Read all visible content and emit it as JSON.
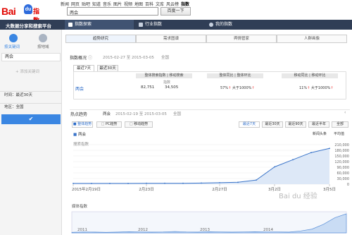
{
  "topnav": {
    "links": [
      "新闻",
      "网页",
      "贴吧",
      "知道",
      "音乐",
      "图片",
      "视频",
      "地图",
      "百科",
      "文库",
      "风云榜"
    ],
    "active": "指数"
  },
  "logo": {
    "text_bai": "Bai",
    "text_du": "du",
    "text_index": "指数"
  },
  "search": {
    "value": "两会",
    "button": "百度一下"
  },
  "header": {
    "brand": "大数据分享和搜索平台",
    "tabs": [
      "指数探索",
      "行业指数",
      "我的指数"
    ],
    "colors": {
      "bar": "#303e56",
      "active": "#405372"
    }
  },
  "subtabs": [
    "趋势研究",
    "需求图谱",
    "舆情管家",
    "人群画像"
  ],
  "sidebar": {
    "btn_keyword": "按关键词",
    "btn_region": "按地域",
    "keyword": "两会",
    "add": "+ 添加关键词",
    "time_label": "时间：最近30天",
    "region_label": "地区：全国",
    "ok_icon": "check-icon"
  },
  "overview": {
    "title": "指数概况",
    "date_range": "2015-02-27 至 2015-03-05",
    "region": "全国",
    "tabs": [
      "最近7天",
      "最近30天"
    ],
    "col_headers": [
      "整体搜索指数",
      "移动搜索",
      "整体同比",
      "整体环比",
      "移动同比",
      "移动环比"
    ],
    "sub_label": "指数",
    "keyword": "两会",
    "values": {
      "overall": "82,751",
      "mobile": "34,505",
      "yoy_overall": "57%",
      "mom_overall": "大于1000%",
      "yoy_mobile": "11%",
      "mom_mobile": "大于1000%"
    }
  },
  "trend": {
    "title": "热点趋势",
    "keyword": "两会",
    "date_range": "2015-02-19 至 2015-03-05",
    "region": "全国",
    "view_tabs": [
      "整体趋势",
      "PC趋势",
      "移动趋势"
    ],
    "range_buttons": [
      "最近7天",
      "最近30天",
      "最近90天",
      "最近半年",
      "全部"
    ],
    "legend": "两会",
    "right_labels": [
      "新闻头条",
      "平均值"
    ],
    "y_label": "搜索指数",
    "overview_label": "媒体指数"
  },
  "chart_data": {
    "type": "line",
    "title": "",
    "xlabel": "",
    "ylabel": "搜索指数",
    "ylim": [
      0,
      210000
    ],
    "y_ticks": [
      0,
      30000,
      60000,
      90000,
      120000,
      150000,
      180000,
      210000
    ],
    "x_tick_labels": [
      "2015年2月19日",
      "2月23日",
      "2月27日",
      "3月2日",
      "3月5日"
    ],
    "grid": true,
    "series": [
      {
        "name": "两会",
        "x": [
          "2015-02-19",
          "2015-02-20",
          "2015-02-21",
          "2015-02-22",
          "2015-02-23",
          "2015-02-24",
          "2015-02-25",
          "2015-02-26",
          "2015-02-27",
          "2015-02-28",
          "2015-03-01",
          "2015-03-02",
          "2015-03-03",
          "2015-03-04",
          "2015-03-05"
        ],
        "values": [
          4000,
          4000,
          4000,
          4000,
          5000,
          5000,
          5000,
          6000,
          8000,
          10000,
          22000,
          92000,
          130000,
          168000,
          190000
        ]
      }
    ],
    "overview_axis": [
      "2011",
      "2012",
      "2013",
      "2014"
    ]
  },
  "watermark": "Bai du 经验",
  "share_icon": "share-icon"
}
